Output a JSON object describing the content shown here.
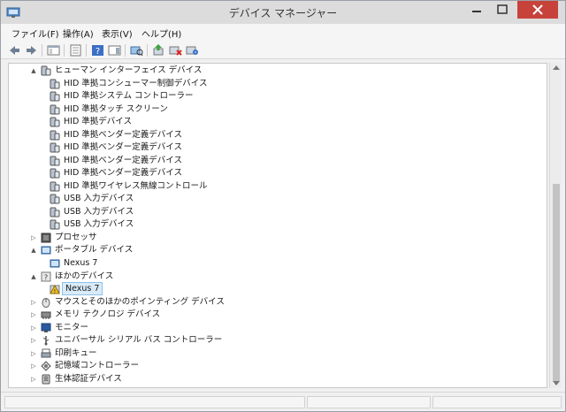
{
  "window": {
    "title": "デバイス マネージャー"
  },
  "menu": [
    {
      "label": "ファイル(F)"
    },
    {
      "label": "操作(A)"
    },
    {
      "label": "表示(V)"
    },
    {
      "label": "ヘルプ(H)"
    }
  ],
  "toolbar_icons": [
    "back-arrow-icon",
    "forward-arrow-icon",
    "show-hide-console-tree-icon",
    "properties-icon",
    "help-icon",
    "show-action-pane-icon",
    "scan-hardware-icon",
    "update-driver-icon",
    "disable-device-icon",
    "uninstall-device-icon"
  ],
  "tree": [
    {
      "label": "ヒューマン インターフェイス デバイス",
      "expander": "▲",
      "icon": "hid-category-icon"
    },
    {
      "label": "HID 準拠コンシューマー制御デバイス",
      "icon": "hid-device-icon"
    },
    {
      "label": "HID 準拠システム コントローラー",
      "icon": "hid-device-icon"
    },
    {
      "label": "HID 準拠タッチ スクリーン",
      "icon": "hid-device-icon"
    },
    {
      "label": "HID 準拠デバイス",
      "icon": "hid-device-icon"
    },
    {
      "label": "HID 準拠ベンダー定義デバイス",
      "icon": "hid-device-icon"
    },
    {
      "label": "HID 準拠ベンダー定義デバイス",
      "icon": "hid-device-icon"
    },
    {
      "label": "HID 準拠ベンダー定義デバイス",
      "icon": "hid-device-icon"
    },
    {
      "label": "HID 準拠ベンダー定義デバイス",
      "icon": "hid-device-icon"
    },
    {
      "label": "HID 準拠ワイヤレス無線コントロール",
      "icon": "hid-device-icon"
    },
    {
      "label": "USB 入力デバイス",
      "icon": "hid-device-icon"
    },
    {
      "label": "USB 入力デバイス",
      "icon": "hid-device-icon"
    },
    {
      "label": "USB 入力デバイス",
      "icon": "hid-device-icon"
    },
    {
      "label": "プロセッサ",
      "expander": "▷",
      "icon": "processor-icon"
    },
    {
      "label": "ポータブル デバイス",
      "expander": "▲",
      "icon": "portable-device-icon"
    },
    {
      "label": "Nexus 7",
      "icon": "portable-device-icon"
    },
    {
      "label": "ほかのデバイス",
      "expander": "▲",
      "icon": "other-devices-icon"
    },
    {
      "label": "Nexus 7",
      "icon": "warning-device-icon"
    },
    {
      "label": "マウスとそのほかのポインティング デバイス",
      "expander": "▷",
      "icon": "mouse-icon"
    },
    {
      "label": "メモリ テクノロジ デバイス",
      "expander": "▷",
      "icon": "memory-icon"
    },
    {
      "label": "モニター",
      "expander": "▷",
      "icon": "monitor-icon"
    },
    {
      "label": "ユニバーサル シリアル バス コントローラー",
      "expander": "▷",
      "icon": "usb-icon"
    },
    {
      "label": "印刷キュー",
      "expander": "▷",
      "icon": "printer-icon"
    },
    {
      "label": "記憶域コントローラー",
      "expander": "▷",
      "icon": "storage-controller-icon"
    },
    {
      "label": "生体認証デバイス",
      "expander": "▷",
      "icon": "biometric-icon"
    }
  ],
  "colors": {
    "selection_bg": "#d9ebf9",
    "selection_border": "#8ec1ea",
    "close_button": "#c7423a"
  }
}
